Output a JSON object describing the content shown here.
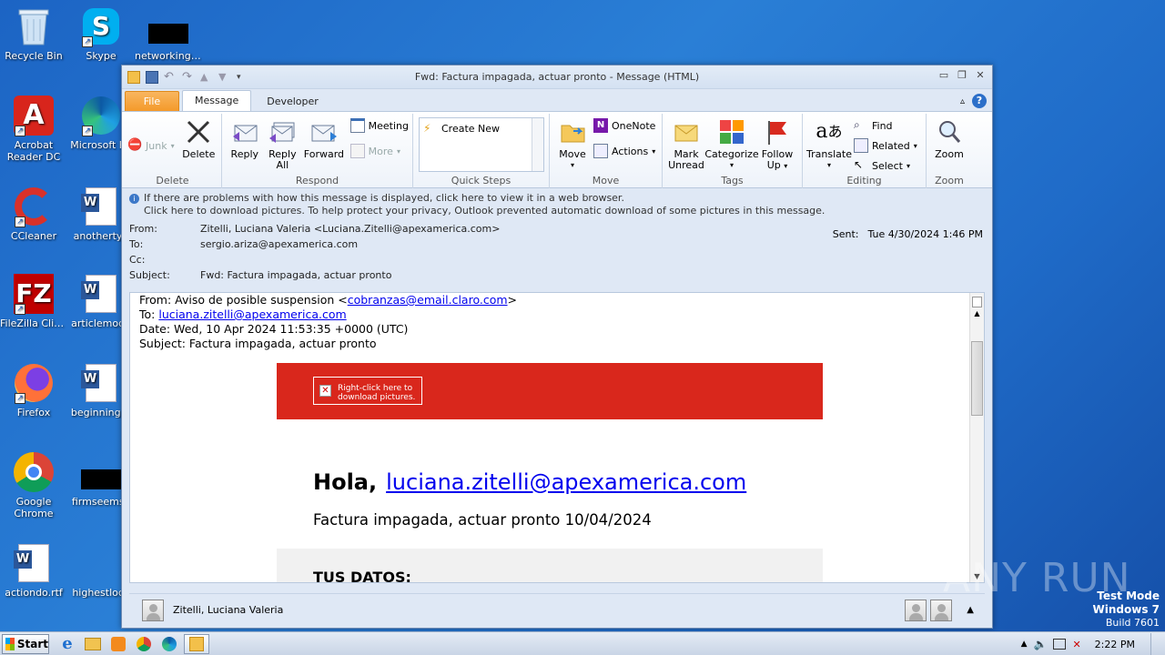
{
  "desktop": {
    "icons": [
      {
        "label": "Recycle Bin",
        "icon": "recycle-bin-icon"
      },
      {
        "label": "Skype",
        "icon": "skype-icon"
      },
      {
        "label": "networkinge...",
        "icon": "file-icon"
      },
      {
        "label": "Acrobat Reader DC",
        "icon": "acrobat-icon"
      },
      {
        "label": "Microsoft Ed",
        "icon": "edge-icon"
      },
      {
        "label": "CCleaner",
        "icon": "ccleaner-icon"
      },
      {
        "label": "anothertyp",
        "icon": "word-doc-icon"
      },
      {
        "label": "FileZilla Client",
        "icon": "filezilla-icon"
      },
      {
        "label": "articlemode",
        "icon": "word-doc-icon"
      },
      {
        "label": "Firefox",
        "icon": "firefox-icon"
      },
      {
        "label": "beginningpr",
        "icon": "word-doc-icon"
      },
      {
        "label": "Google Chrome",
        "icon": "chrome-icon"
      },
      {
        "label": "firmseems.j",
        "icon": "file-icon"
      },
      {
        "label": "actiondo.rtf",
        "icon": "word-doc-icon"
      },
      {
        "label": "highestloca",
        "icon": "file-icon"
      }
    ]
  },
  "window": {
    "title": "Fwd: Factura impagada, actuar pronto  -  Message (HTML)",
    "tabs": [
      "File",
      "Message",
      "Developer"
    ],
    "active_tab": "Message"
  },
  "ribbon": {
    "delete": {
      "junk": "Junk",
      "delete": "Delete",
      "label": "Delete"
    },
    "respond": {
      "reply": "Reply",
      "reply_all_1": "Reply",
      "reply_all_2": "All",
      "forward": "Forward",
      "meeting": "Meeting",
      "more": "More",
      "label": "Respond"
    },
    "quick_steps": {
      "create_new": "Create New",
      "label": "Quick Steps"
    },
    "move": {
      "move": "Move",
      "onenote": "OneNote",
      "actions": "Actions",
      "label": "Move"
    },
    "tags": {
      "mark_1": "Mark",
      "mark_2": "Unread",
      "categorize": "Categorize",
      "follow_1": "Follow",
      "follow_2": "Up",
      "label": "Tags"
    },
    "editing": {
      "translate": "Translate",
      "find": "Find",
      "related": "Related",
      "select": "Select",
      "label": "Editing"
    },
    "zoom": {
      "zoom": "Zoom",
      "label": "Zoom"
    }
  },
  "message": {
    "info_line1": "If there are problems with how this message is displayed, click here to view it in a web browser.",
    "info_line2": "Click here to download pictures. To help protect your privacy, Outlook prevented automatic download of some pictures in this message.",
    "from_label": "From:",
    "from": "Zitelli, Luciana Valeria <Luciana.Zitelli@apexamerica.com>",
    "to_label": "To:",
    "to": "sergio.ariza@apexamerica.com",
    "cc_label": "Cc:",
    "subject_label": "Subject:",
    "subject": "Fwd: Factura impagada, actuar pronto",
    "sent_label": "Sent:",
    "sent": "Tue 4/30/2024 1:46 PM"
  },
  "body": {
    "fwd_from_prefix": "From: Aviso de posible suspension <",
    "fwd_from_email": "cobranzas@email.claro.com",
    "fwd_from_suffix": ">",
    "fwd_to_prefix": "To: ",
    "fwd_to_email": "luciana.zitelli@apexamerica.com",
    "fwd_date": "Date: Wed, 10 Apr 2024 11:53:35 +0000 (UTC)",
    "fwd_subject": "Subject: Factura impagada, actuar pronto",
    "image_placeholder": "Right-click here to download pictures.",
    "greeting": "Hola,",
    "greeting_email": "luciana.zitelli@apexamerica.com",
    "invoice_line": "Factura impagada, actuar pronto 10/04/2024",
    "section_title": "TUS DATOS:"
  },
  "people_pane": {
    "name": "Zitelli, Luciana Valeria"
  },
  "taskbar": {
    "start": "Start",
    "time": "2:22 PM"
  },
  "watermark": {
    "line1": "Test Mode",
    "line2": "Windows 7",
    "line3": "Build 7601",
    "brand": "ANY RUN"
  }
}
